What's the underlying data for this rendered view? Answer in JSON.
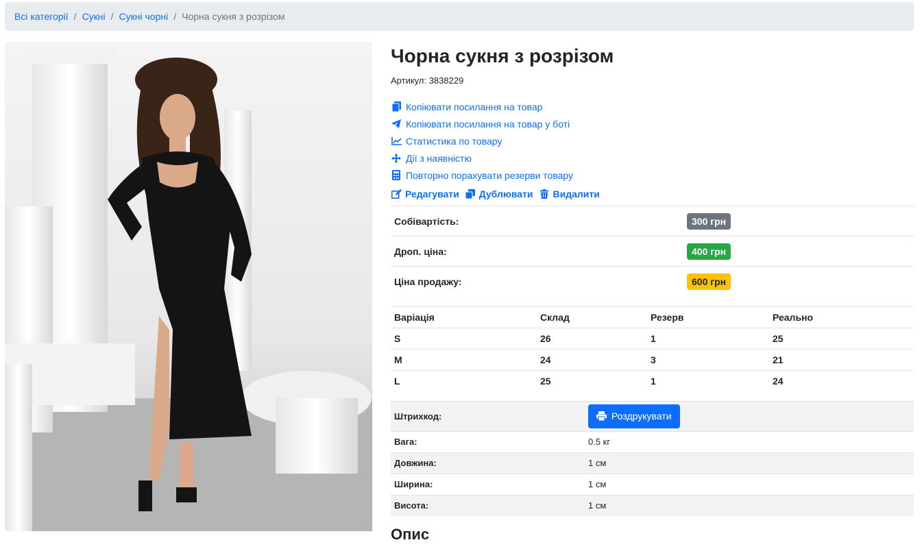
{
  "breadcrumb": {
    "items": [
      "Всі категорії",
      "Сукні",
      "Сукні чорні"
    ],
    "active": "Чорна сукня з розрізом"
  },
  "product": {
    "title": "Чорна сукня з розрізом",
    "sku": "Артикул: 3838229"
  },
  "actions": [
    {
      "label": "Копіювати посилання на товар",
      "icon": "copy-icon"
    },
    {
      "label": "Копіювати посилання на товар у боті",
      "icon": "telegram-icon"
    },
    {
      "label": "Статистика по товару",
      "icon": "chart-line-icon"
    },
    {
      "label": "Дії з наявністю",
      "icon": "arrows-move-icon"
    },
    {
      "label": "Повторно порахувати резерви товару",
      "icon": "calculator-icon"
    }
  ],
  "edit_actions": {
    "edit": "Редагувати",
    "duplicate": "Дублювати",
    "delete": "Видалити"
  },
  "prices": [
    {
      "label": "Собівартість:",
      "value": "300 грн",
      "color": "#6c757d"
    },
    {
      "label": "Дроп. ціна:",
      "value": "400 грн",
      "color": "#28a745"
    },
    {
      "label": "Ціна продажу:",
      "value": "600 грн",
      "color": "#ffc107"
    }
  ],
  "variations": {
    "headers": [
      "Варіація",
      "Склад",
      "Резерв",
      "Реально"
    ],
    "rows": [
      [
        "S",
        "26",
        "1",
        "25"
      ],
      [
        "M",
        "24",
        "3",
        "21"
      ],
      [
        "L",
        "25",
        "1",
        "24"
      ]
    ]
  },
  "specs": {
    "barcode_label": "Штрихкод:",
    "print_button": "Роздрукувати",
    "rows": [
      {
        "label": "Вага:",
        "value": "0.5 кг"
      },
      {
        "label": "Довжина:",
        "value": "1 см"
      },
      {
        "label": "Ширина:",
        "value": "1 см"
      },
      {
        "label": "Висота:",
        "value": "1 см"
      }
    ]
  },
  "description_heading": "Опис",
  "colors": {
    "link": "#0d6efd",
    "breadcrumb_bg": "#e9ecef"
  }
}
